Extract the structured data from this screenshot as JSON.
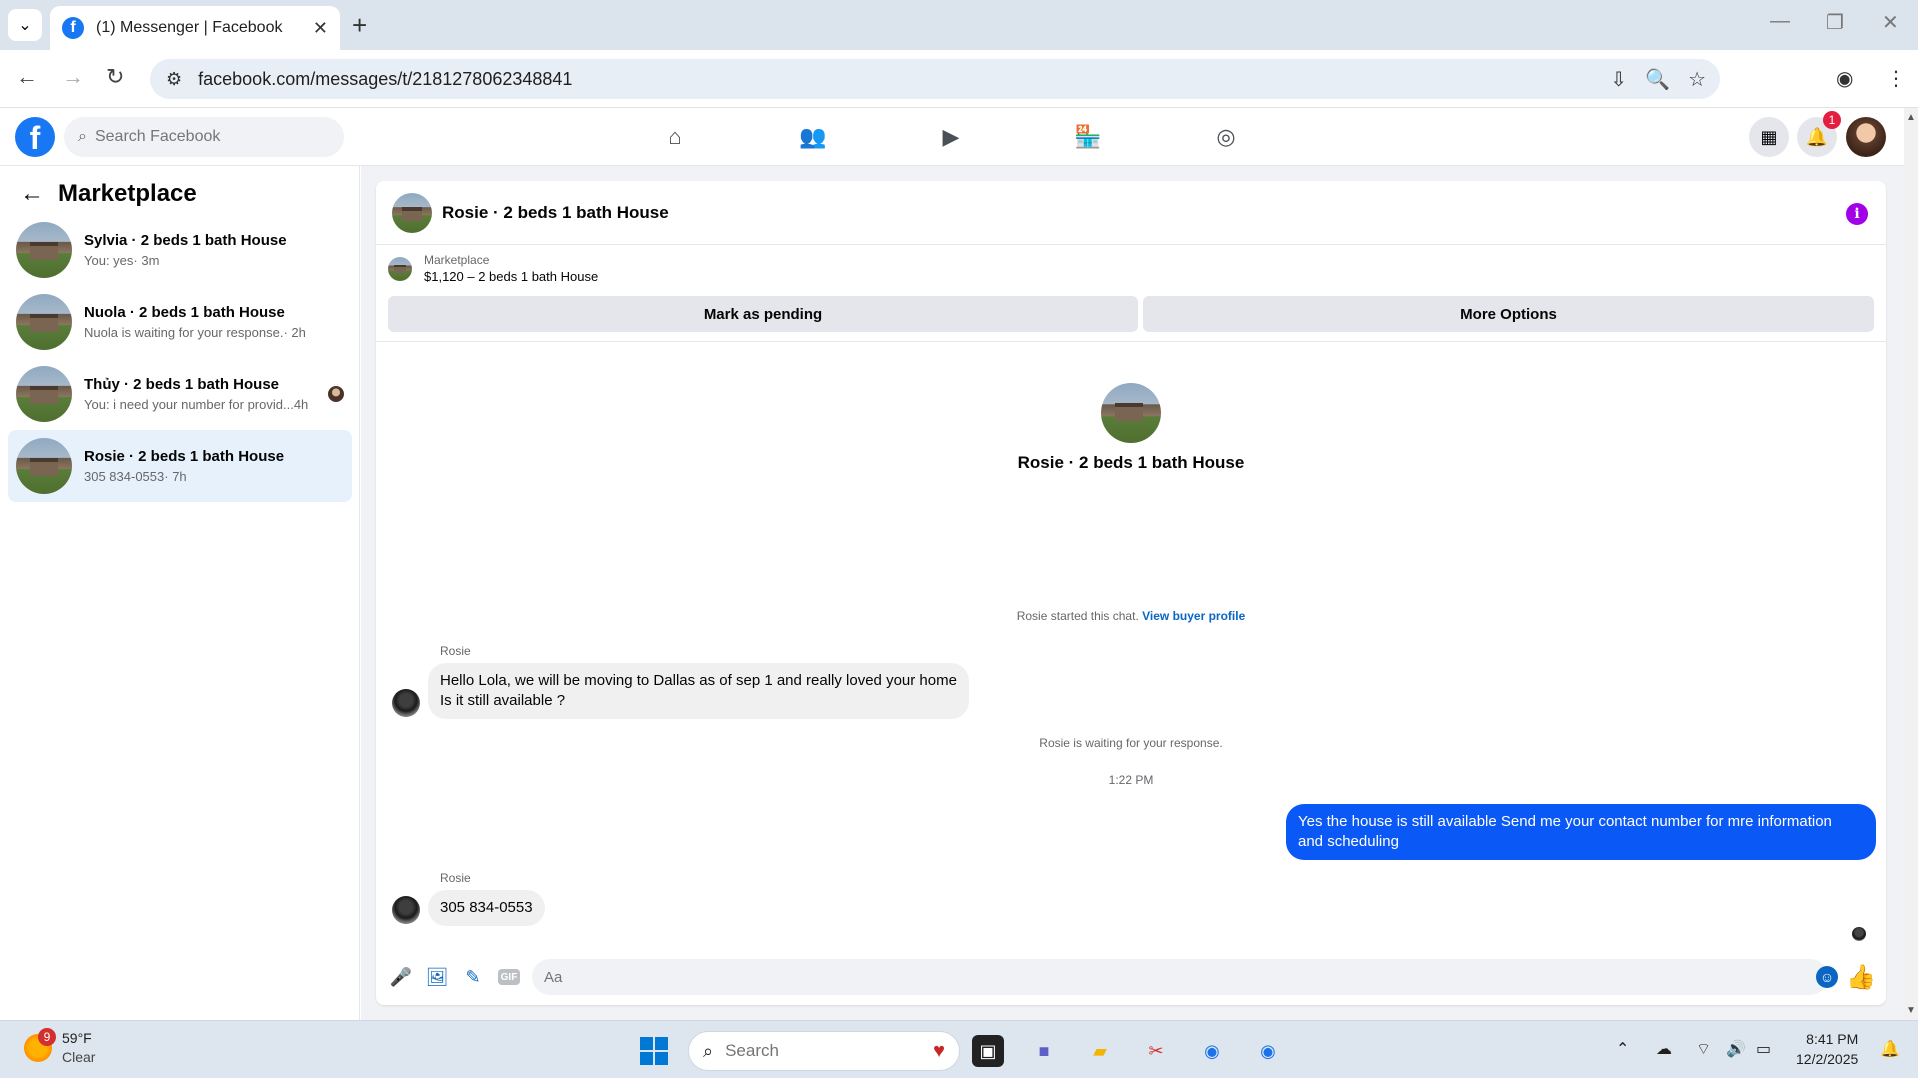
{
  "browser": {
    "tab_title": "(1) Messenger | Facebook",
    "url": "facebook.com/messages/t/2181278062348841"
  },
  "fb": {
    "search_placeholder": "Search Facebook",
    "notification_count": "1"
  },
  "sidebar": {
    "title": "Marketplace",
    "conversations": [
      {
        "name": "Sylvia · 2 beds 1 bath House",
        "preview": "You: yes",
        "time": " · 3m"
      },
      {
        "name": "Nuola · 2 beds 1 bath House",
        "preview": "Nuola is waiting for your response.",
        "time": " · 2h"
      },
      {
        "name": "Thủy · 2 beds 1 bath House",
        "preview": "You: i need your number for provid...",
        "time": " 4h"
      },
      {
        "name": "Rosie · 2 beds 1 bath House",
        "preview": "305 834-0553",
        "time": " · 7h"
      }
    ]
  },
  "chat": {
    "header_name": "Rosie · 2 beds 1 bath House",
    "listing_source": "Marketplace",
    "listing_title": "$1,120 – 2 beds 1 bath House",
    "mark_pending_label": "Mark as pending",
    "more_options_label": "More Options",
    "profile_name": "Rosie · 2 beds 1 bath House",
    "started_text": "Rosie started this chat.",
    "view_profile_link": "View buyer profile",
    "messages": {
      "m1_sender": "Rosie",
      "m1_line1": "Hello Lola, we will be moving to Dallas as of sep 1 and really loved your home",
      "m1_line2": "Is it still available ?",
      "waiting_text": "Rosie is waiting for your response.",
      "timestamp": "1:22 PM",
      "m2_line1": "Yes the house is still available  Send me your contact number for mre information",
      "m2_line2": "and  scheduling",
      "m3_sender": "Rosie",
      "m3_text": "305 834-0553"
    },
    "composer_placeholder": "Aa",
    "gif_label": "GIF"
  },
  "taskbar": {
    "weather_badge": "9",
    "temperature": "59°F",
    "condition": "Clear",
    "search_placeholder": "Search",
    "time": "8:41 PM",
    "date": "12/2/2025"
  }
}
